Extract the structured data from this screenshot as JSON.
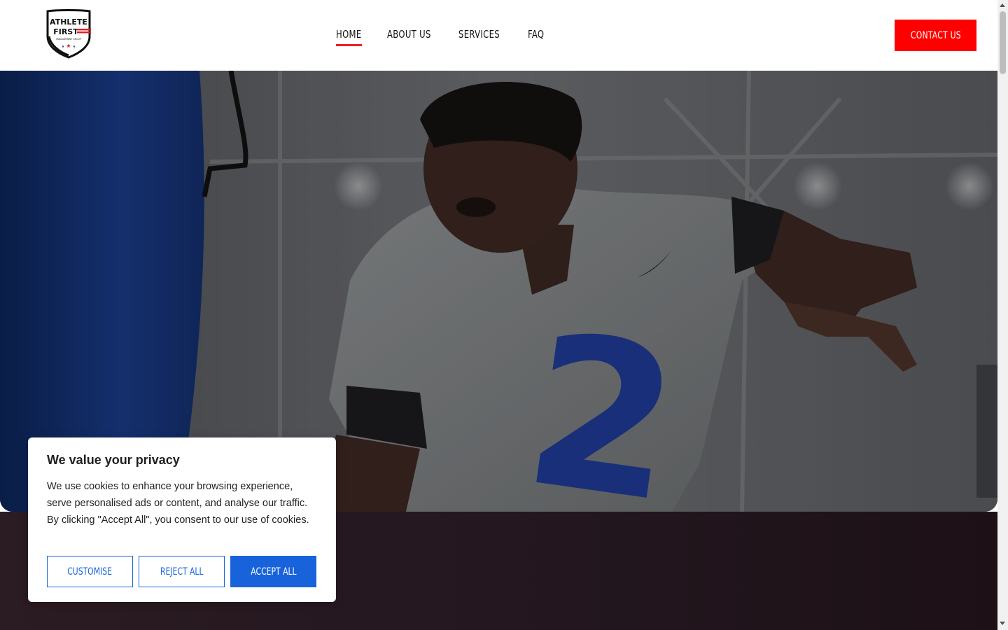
{
  "header": {
    "logo": {
      "line1": "ATHLETE",
      "line2": "FIRST",
      "tagline": "MANAGEMENT GROUP"
    },
    "nav": [
      {
        "label": "HOME",
        "active": true
      },
      {
        "label": "ABOUT US",
        "active": false
      },
      {
        "label": "SERVICES",
        "active": false
      },
      {
        "label": "FAQ",
        "active": false
      }
    ],
    "contact_label": "CONTACT US"
  },
  "hero": {
    "jersey_number": "2"
  },
  "cookie_banner": {
    "title": "We value your privacy",
    "text": "We use cookies to enhance your browsing experience, serve personalised ads or content, and analyse our traffic. By clicking \"Accept All\", you consent to our use of cookies.",
    "customise_label": "CUSTOMISE",
    "reject_label": "REJECT ALL",
    "accept_label": "ACCEPT ALL"
  },
  "colors": {
    "brand_red": "#ff0000",
    "nav_underline": "#ee1c25",
    "cookie_blue": "#1863dc",
    "dark_band": "#241720"
  },
  "icons": {
    "logo": "athlete-first-shield-logo"
  }
}
